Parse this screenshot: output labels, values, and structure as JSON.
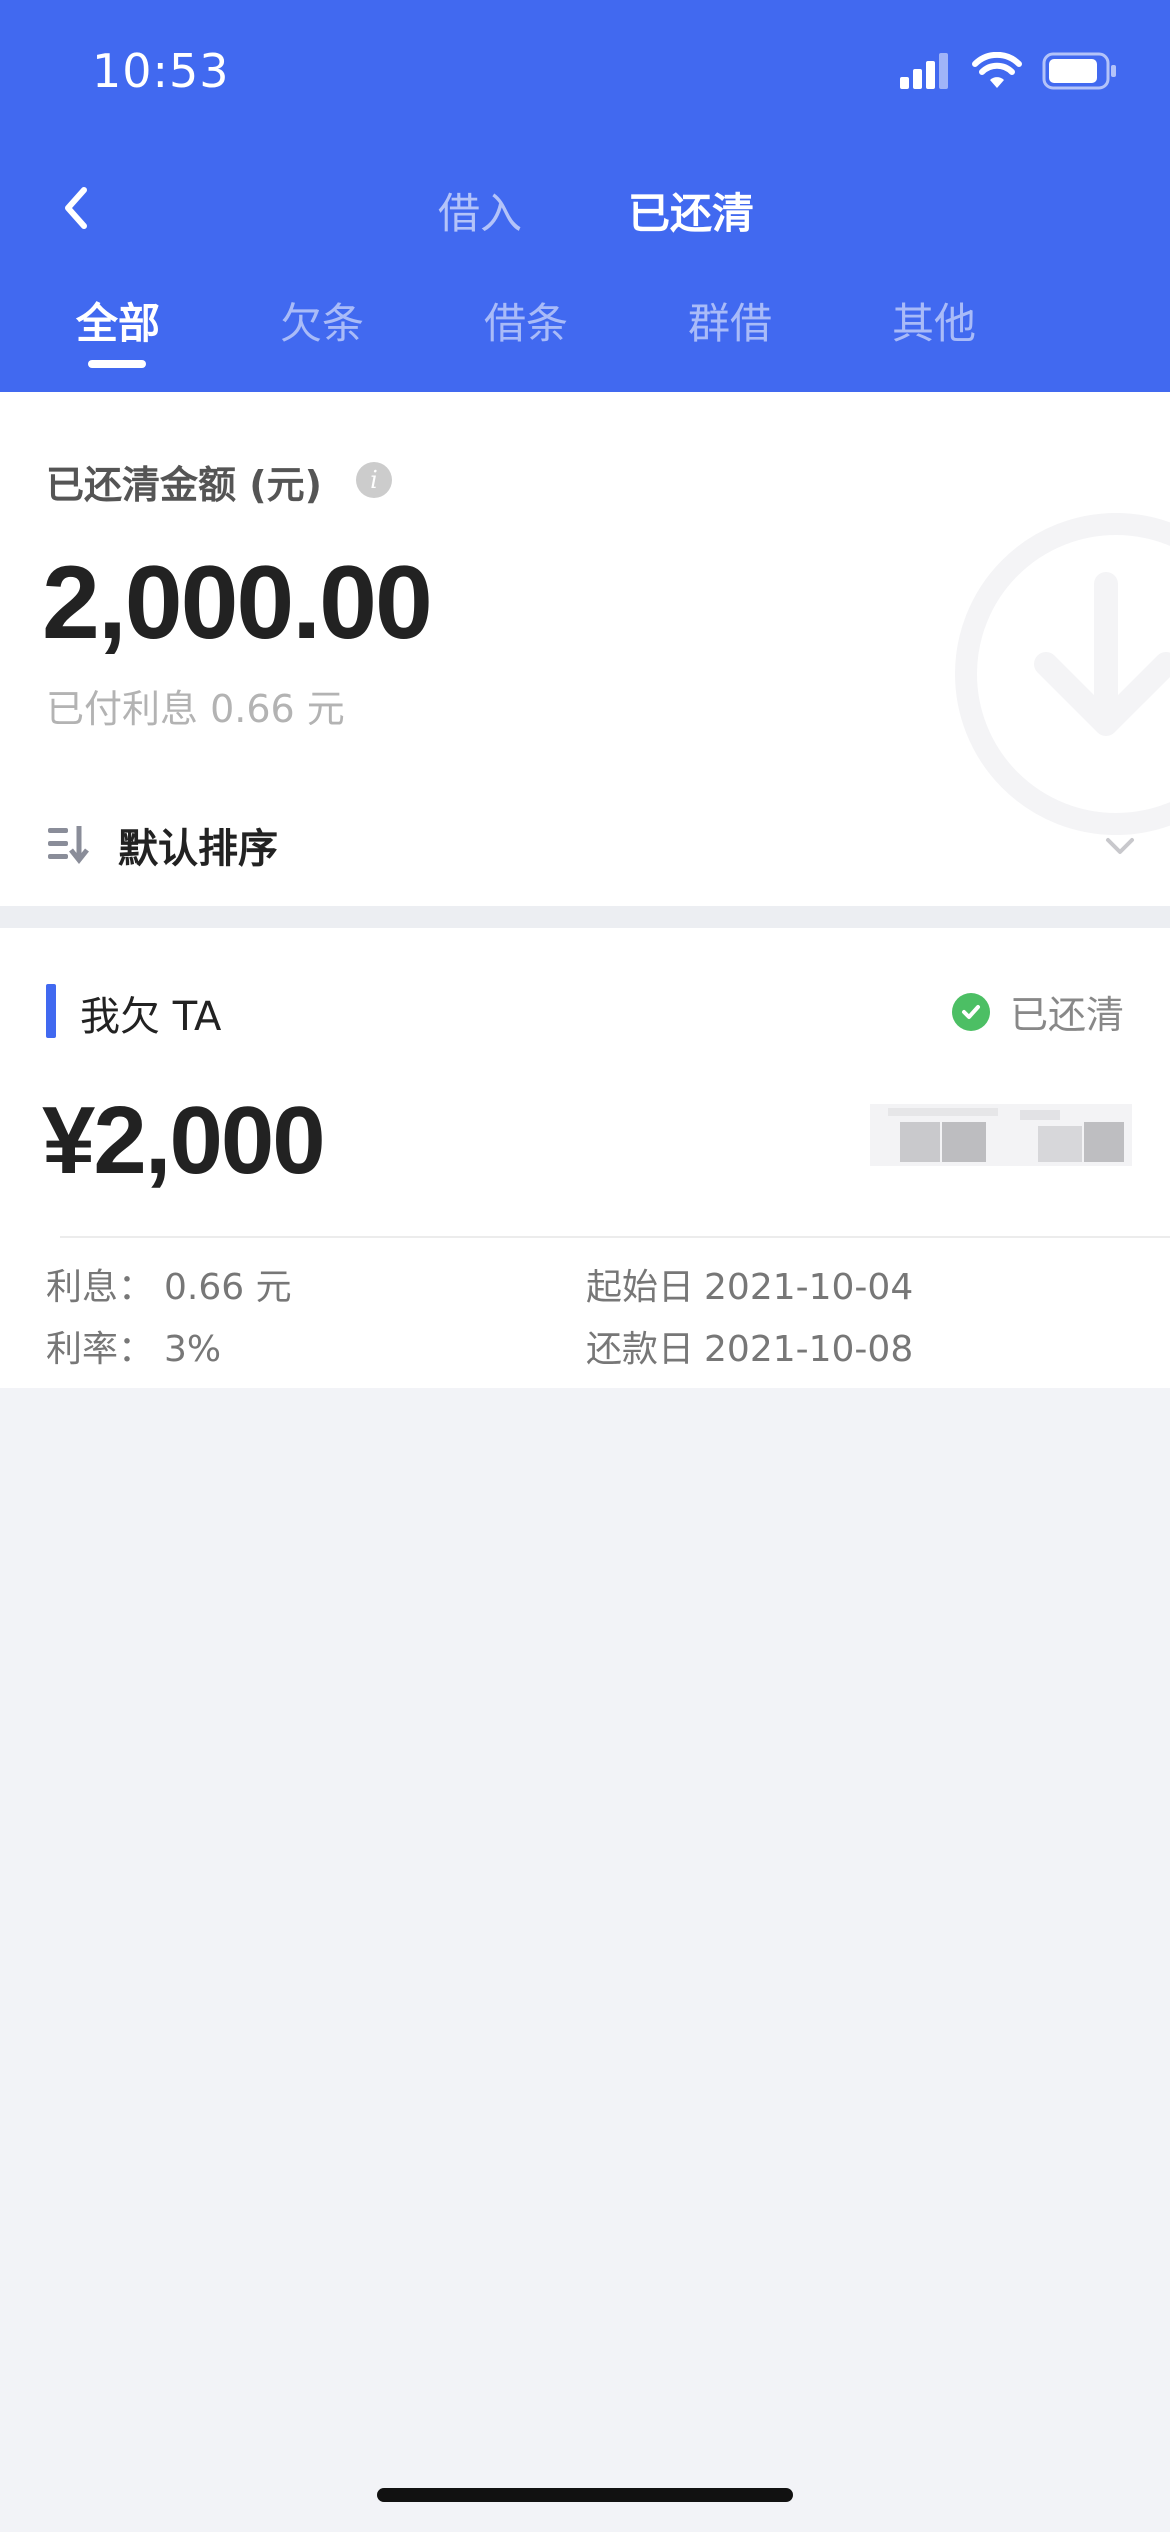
{
  "status_bar": {
    "time": "10:53"
  },
  "nav": {
    "tabs": [
      {
        "label": "借入"
      },
      {
        "label": "已还清"
      }
    ]
  },
  "categories": [
    {
      "label": "全部"
    },
    {
      "label": "欠条"
    },
    {
      "label": "借条"
    },
    {
      "label": "群借"
    },
    {
      "label": "其他"
    }
  ],
  "summary": {
    "label": "已还清金额 (元)",
    "info_icon": "i",
    "amount": "2,000.00",
    "interest_paid": "已付利息 0.66 元",
    "sort_label": "默认排序"
  },
  "card": {
    "title": "我欠 TA",
    "status": "已还清",
    "amount": "¥2,000",
    "interest_label": "利息：",
    "interest_value": "0.66 元",
    "rate_label": "利率：",
    "rate_value": "3%",
    "start_label": "起始日",
    "start_value": "2021-10-04",
    "repay_label": "还款日",
    "repay_value": "2021-10-08"
  },
  "colors": {
    "accent": "#4169f0",
    "status_green": "#4cbf64",
    "background": "#f2f3f7"
  }
}
